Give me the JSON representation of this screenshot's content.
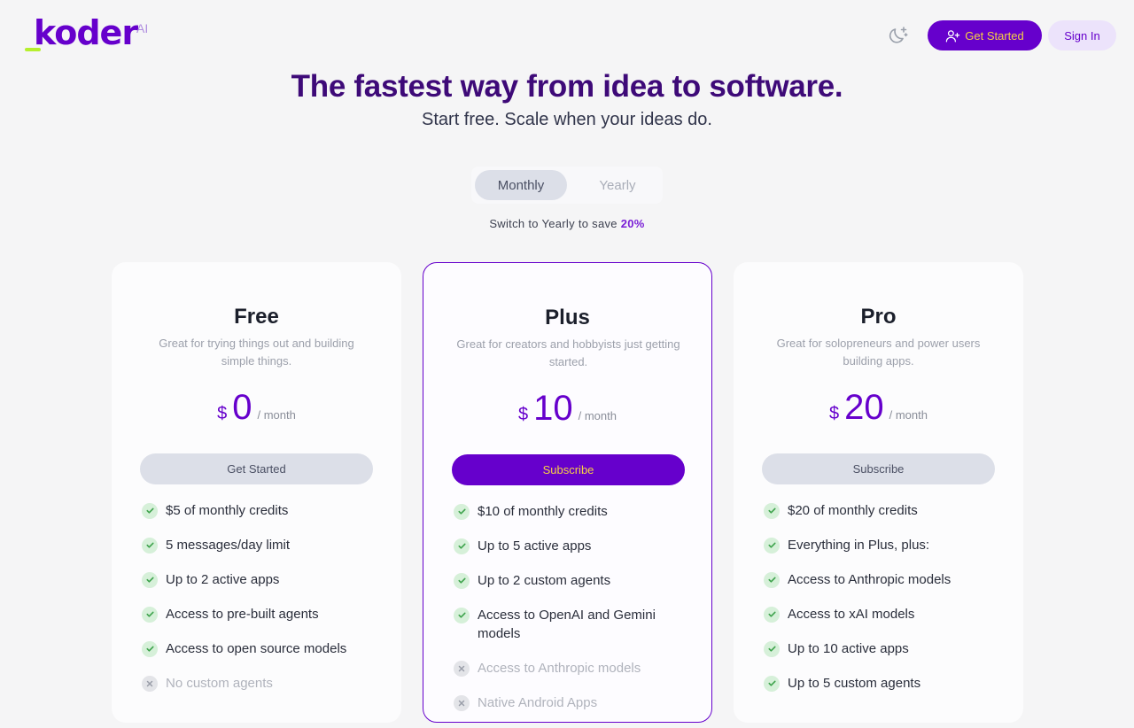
{
  "brand": {
    "name": "koder",
    "suffix": "AI"
  },
  "header": {
    "theme_toggle_icon": "moon-sparkle-icon",
    "get_started_label": "Get Started",
    "get_started_icon": "user-plus-icon",
    "sign_in_label": "Sign In"
  },
  "hero": {
    "title": "The fastest way from idea to software.",
    "subtitle": "Start free. Scale when your ideas do."
  },
  "billing": {
    "options": [
      "Monthly",
      "Yearly"
    ],
    "selected": "Monthly",
    "save_note_prefix": "Switch to Yearly to save",
    "save_percent": "20%"
  },
  "colors": {
    "accent": "#6600cc",
    "accent_text": "#f6d043",
    "title": "#3e0a78",
    "check_bg": "#d6f0d9",
    "check_mark": "#3fa34d",
    "cross_bg": "#e3e4e8"
  },
  "plans": [
    {
      "name": "Free",
      "description": "Great for trying things out and building simple things.",
      "currency": "$",
      "price": "0",
      "period": "/ month",
      "cta": "Get Started",
      "featured": false,
      "features": [
        {
          "text": "$5 of monthly credits",
          "included": true
        },
        {
          "text": "5 messages/day limit",
          "included": true
        },
        {
          "text": "Up to 2 active apps",
          "included": true
        },
        {
          "text": "Access to pre-built agents",
          "included": true
        },
        {
          "text": "Access to open source models",
          "included": true
        },
        {
          "text": "No custom agents",
          "included": false
        }
      ]
    },
    {
      "name": "Plus",
      "description": "Great for creators and hobbyists just getting started.",
      "currency": "$",
      "price": "10",
      "period": "/ month",
      "cta": "Subscribe",
      "featured": true,
      "features": [
        {
          "text": "$10 of monthly credits",
          "included": true
        },
        {
          "text": "Up to 5 active apps",
          "included": true
        },
        {
          "text": "Up to 2 custom agents",
          "included": true
        },
        {
          "text": "Access to OpenAI and Gemini models",
          "included": true
        },
        {
          "text": "Access to Anthropic models",
          "included": false
        },
        {
          "text": "Native Android Apps",
          "included": false
        }
      ]
    },
    {
      "name": "Pro",
      "description": "Great for solopreneurs and power users building apps.",
      "currency": "$",
      "price": "20",
      "period": "/ month",
      "cta": "Subscribe",
      "featured": false,
      "features": [
        {
          "text": "$20 of monthly credits",
          "included": true
        },
        {
          "text": "Everything in Plus, plus:",
          "included": true
        },
        {
          "text": "Access to Anthropic models",
          "included": true
        },
        {
          "text": "Access to xAI models",
          "included": true
        },
        {
          "text": "Up to 10 active apps",
          "included": true
        },
        {
          "text": "Up to 5 custom agents",
          "included": true
        }
      ]
    }
  ]
}
